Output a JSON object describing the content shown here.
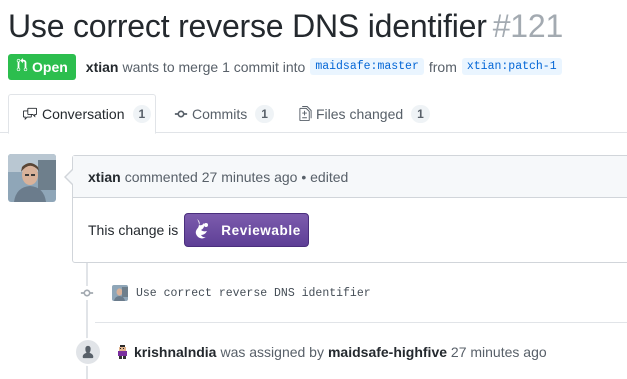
{
  "pr": {
    "title": "Use correct reverse DNS identifier",
    "number": "#121",
    "state": "Open",
    "author": "xtian",
    "summary": "wants to merge 1 commit into",
    "base_repo": "maidsafe",
    "base_branch": "master",
    "from_word": "from",
    "head_repo": "xtian",
    "head_branch": "patch-1"
  },
  "tabs": [
    {
      "label": "Conversation",
      "count": "1",
      "icon": "comment-discussion-icon",
      "selected": true
    },
    {
      "label": "Commits",
      "count": "1",
      "icon": "git-commit-icon",
      "selected": false
    },
    {
      "label": "Files changed",
      "count": "1",
      "icon": "diff-icon",
      "selected": false
    }
  ],
  "comment": {
    "author": "xtian",
    "action": "commented",
    "time": "27 minutes ago",
    "edited": "• edited",
    "body_text": "This change is",
    "badge_label": "Reviewable"
  },
  "commit": {
    "message": "Use correct reverse DNS identifier"
  },
  "event": {
    "assignee": "krishnalndia",
    "text": "was assigned by",
    "actor": "maidsafe-highfive",
    "time": "27 minutes ago"
  },
  "colors": {
    "open_green": "#2cbe4e",
    "reviewable_purple": "#6b4ba1",
    "link_blue": "#0366d6"
  }
}
